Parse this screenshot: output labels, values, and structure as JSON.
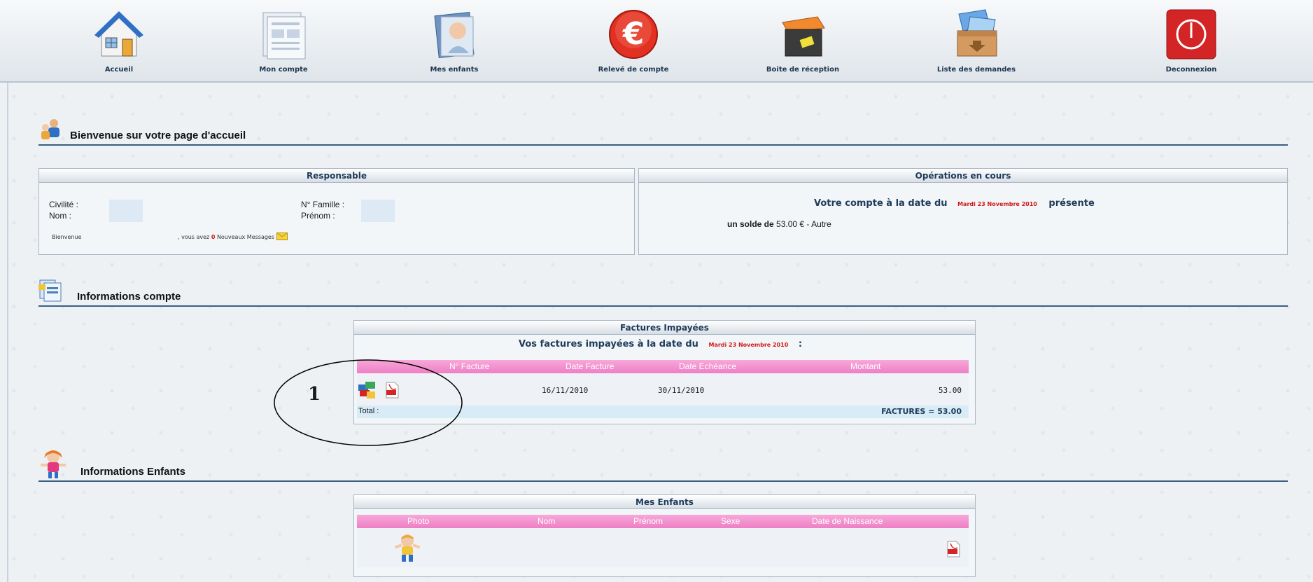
{
  "nav": [
    {
      "label": "Accueil",
      "icon": "home-icon"
    },
    {
      "label": "Mon compte",
      "icon": "account-document-icon"
    },
    {
      "label": "Mes enfants",
      "icon": "children-photo-icon"
    },
    {
      "label": "Relevé de compte",
      "icon": "euro-icon"
    },
    {
      "label": "Boite de réception",
      "icon": "inbox-icon"
    },
    {
      "label": "Liste des demandes",
      "icon": "requests-box-icon"
    },
    {
      "label": "Deconnexion",
      "icon": "power-icon"
    }
  ],
  "welcome": {
    "title": "Bienvenue sur votre page d'accueil"
  },
  "responsable": {
    "title": "Responsable",
    "civilite_label": "Civilité :",
    "nom_label": "Nom :",
    "famille_label": "N° Famille :",
    "prenom_label": "Prénom :",
    "bienvenue": "Bienvenue",
    "messages_prefix": ", vous avez",
    "messages_count": "0",
    "messages_suffix": "Nouveaux Messages"
  },
  "operations": {
    "title": "Opérations en cours",
    "line1_prefix": "Votre compte à la date du",
    "date": "Mardi 23 Novembre 2010",
    "line1_suffix": "présente",
    "solde_label": "un solde de",
    "solde_value": "53.00 € - Autre"
  },
  "account_section": {
    "title": "Informations compte"
  },
  "factures": {
    "title": "Factures Impayées",
    "subtitle_prefix": "Vos factures impayées à la date du",
    "date": "Mardi 23 Novembre 2010",
    "subtitle_suffix": ":",
    "columns": [
      "N° Facture",
      "Date Facture",
      "Date Echéance",
      "Montant"
    ],
    "rows": [
      {
        "date_facture": "16/11/2010",
        "date_echeance": "30/11/2010",
        "montant": "53.00"
      }
    ],
    "total_label": "Total :",
    "total_value": "FACTURES = 53.00"
  },
  "annotation": {
    "label": "1"
  },
  "children_section": {
    "title": "Informations Enfants"
  },
  "enfants": {
    "title": "Mes Enfants",
    "columns": [
      "Photo",
      "Nom",
      "Prénom",
      "Sexe",
      "Date de Naissance"
    ]
  }
}
